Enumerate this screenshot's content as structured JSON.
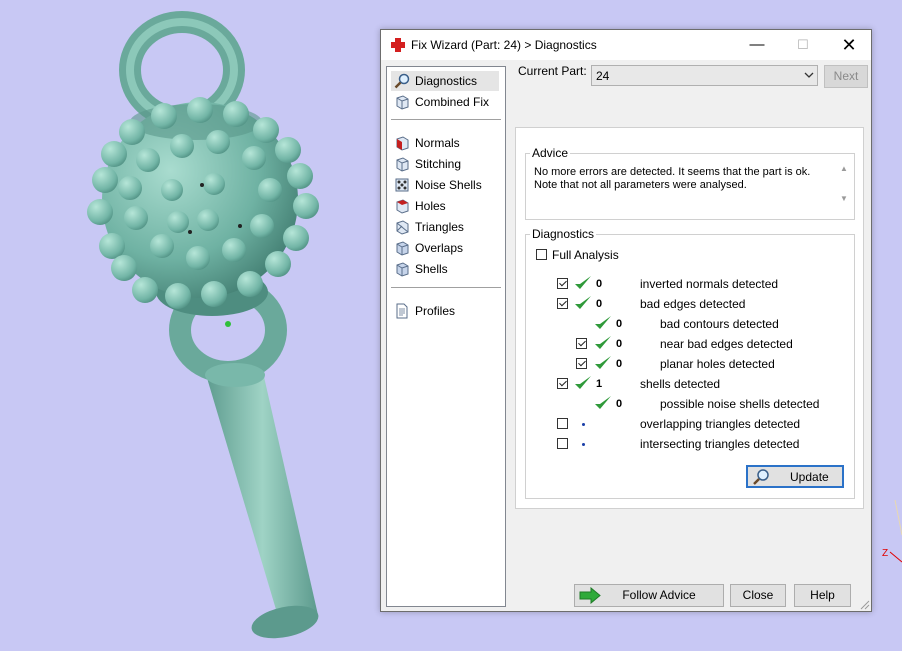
{
  "window": {
    "title": "Fix Wizard (Part: 24) > Diagnostics"
  },
  "nav": {
    "items": [
      {
        "label": "Diagnostics",
        "icon": "magnifier-icon",
        "selected": true
      },
      {
        "label": "Combined Fix",
        "icon": "cube-icon"
      },
      {
        "label": "Normals",
        "icon": "normals-cube-icon"
      },
      {
        "label": "Stitching",
        "icon": "stitching-cube-icon"
      },
      {
        "label": "Noise Shells",
        "icon": "noise-shells-icon"
      },
      {
        "label": "Holes",
        "icon": "holes-cube-icon"
      },
      {
        "label": "Triangles",
        "icon": "triangles-cube-icon"
      },
      {
        "label": "Overlaps",
        "icon": "overlaps-cube-icon"
      },
      {
        "label": "Shells",
        "icon": "shells-cube-icon"
      },
      {
        "label": "Profiles",
        "icon": "document-icon"
      }
    ]
  },
  "current_part": {
    "label": "Current Part:",
    "value": "24",
    "next_label": "Next"
  },
  "advice": {
    "title": "Advice",
    "line1": "No more errors are detected. It seems that the part is ok.",
    "line2": "Note that not all parameters were analysed."
  },
  "diagnostics": {
    "title": "Diagnostics",
    "full_analysis_label": "Full Analysis",
    "rows": [
      {
        "label": "inverted normals detected",
        "count": "0",
        "checked": true,
        "status": "ok"
      },
      {
        "label": "bad edges detected",
        "count": "0",
        "checked": true,
        "status": "ok"
      },
      {
        "label": "bad contours detected",
        "count": "0",
        "status": "ok"
      },
      {
        "label": "near bad edges detected",
        "count": "0",
        "checked": true,
        "status": "ok"
      },
      {
        "label": "planar holes detected",
        "count": "0",
        "checked": true,
        "status": "ok"
      },
      {
        "label": "shells detected",
        "count": "1",
        "checked": true,
        "status": "ok"
      },
      {
        "label": "possible noise shells detected",
        "count": "0",
        "status": "ok"
      },
      {
        "label": "overlapping triangles detected",
        "checked": false,
        "status": "not-run"
      },
      {
        "label": "intersecting triangles detected",
        "checked": false,
        "status": "not-run"
      }
    ],
    "update_label": "Update"
  },
  "buttons": {
    "follow_advice": "Follow Advice",
    "close": "Close",
    "help": "Help"
  },
  "viewport": {
    "axis_label": "Z",
    "background": "#c8c8f4",
    "model_color": "#7bbfb0"
  }
}
